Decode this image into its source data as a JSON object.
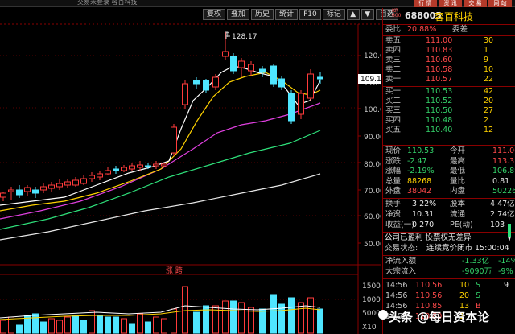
{
  "window": {
    "title": "交易未登录   容百科技"
  },
  "top_tabs": [
    "行 情",
    "资 讯",
    "交 易",
    "网 站"
  ],
  "toolbar": {
    "buttons": [
      "复权",
      "叠加",
      "历史",
      "统计",
      "F10",
      "标记",
      "自选"
    ],
    "prev_icon": "arrow-up-icon",
    "next_icon": "arrow-down-icon"
  },
  "chart": {
    "price_axis_labels": [
      "120.0",
      "110.0",
      "100.0",
      "90.00",
      "80.00",
      "70.00",
      "60.00",
      "50.00"
    ],
    "current_price_tag": "109.15",
    "high_label": "128.17",
    "volume_title": "涨 跨",
    "volume_axis_labels": [
      "15000",
      "10000",
      "5000",
      "X10"
    ],
    "colors": {
      "up": "#ff3b3b",
      "down": "#4fe6ff",
      "ma5": "#ffffff",
      "ma10": "#ffd200",
      "ma20": "#e040e0",
      "ma30": "#2ee07a",
      "ma60": "#e6e6e6"
    }
  },
  "stock": {
    "market": "KR",
    "market2": "600",
    "code": "688005",
    "name": "容百科技"
  },
  "order_book": {
    "committee_ratio_label": "委比",
    "committee_ratio": "20.88%",
    "committee_diff_label": "委差",
    "sell": [
      {
        "label": "卖五",
        "price": "111.00",
        "vol": "30"
      },
      {
        "label": "卖四",
        "price": "110.83",
        "vol": "1"
      },
      {
        "label": "卖三",
        "price": "110.60",
        "vol": "9"
      },
      {
        "label": "卖二",
        "price": "110.58",
        "vol": "10"
      },
      {
        "label": "卖一",
        "price": "110.57",
        "vol": "22"
      }
    ],
    "buy": [
      {
        "label": "买一",
        "price": "110.53",
        "vol": "42"
      },
      {
        "label": "买二",
        "price": "110.52",
        "vol": "20"
      },
      {
        "label": "买三",
        "price": "110.50",
        "vol": "27"
      },
      {
        "label": "买四",
        "price": "110.48",
        "vol": "2"
      },
      {
        "label": "买五",
        "price": "110.40",
        "vol": "12"
      }
    ]
  },
  "quote": {
    "rows": [
      {
        "l1": "现价",
        "v1": "110.53",
        "l2": "今开",
        "v2": "111.00"
      },
      {
        "l1": "涨跌",
        "v1": "-2.47",
        "l2": "最高",
        "v2": "113.37"
      },
      {
        "l1": "涨幅",
        "v1": "-2.19%",
        "l2": "最低",
        "v2": "106.89"
      },
      {
        "l1": "总量",
        "v1": "88268",
        "l2": "量比",
        "v2": "0.81"
      },
      {
        "l1": "外盘",
        "v1": "38042",
        "l2": "内盘",
        "v2": "50226"
      }
    ],
    "rows2": [
      {
        "l1": "换手",
        "v1": "3.22%",
        "l2": "股本",
        "v2": "4.47亿"
      },
      {
        "l1": "净资",
        "v1": "10.31",
        "l2": "流通",
        "v2": "2.74亿"
      },
      {
        "l1": "收益(一)",
        "v1": "0.270",
        "l2": "PE(动)",
        "v2": "103"
      }
    ]
  },
  "notes": {
    "line1": "公司已盈利 投票权无差异",
    "line2_label": "交易状态:",
    "line2_value": "连续竞价闭市 15:00:04"
  },
  "flows": [
    {
      "label": "净流入额",
      "v1": "-1.33亿",
      "v2": "-14%"
    },
    {
      "label": "大宗流入",
      "v1": "-9090万",
      "v2": "-9%"
    }
  ],
  "ticks": [
    {
      "time": "14:56",
      "price": "110.56",
      "vol": "10",
      "side": "S",
      "extra": "9"
    },
    {
      "time": "14:56",
      "price": "110.56",
      "vol": "20",
      "side": "S",
      "extra": ""
    },
    {
      "time": "14:56",
      "price": "110.85",
      "vol": "13",
      "side": "B",
      "extra": ""
    },
    {
      "time": "14:56",
      "price": "110.80",
      "vol": "1",
      "side": "",
      "extra": ""
    }
  ],
  "watermark": "头条 @每日资本论"
}
